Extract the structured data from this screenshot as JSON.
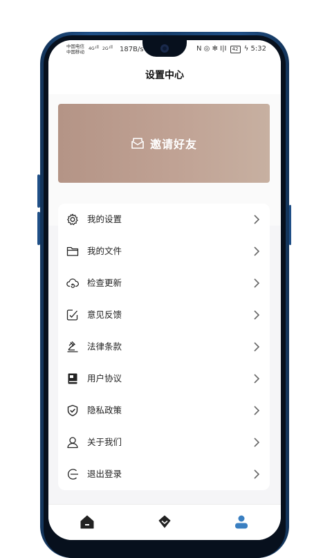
{
  "status_bar": {
    "carrier1": "中国电信",
    "carrier2": "中国移动",
    "net1": "4G",
    "net2": "2G",
    "speed": "187B/s",
    "icons": "N ◎ ✻ I|I",
    "battery": "42",
    "time": "5:32"
  },
  "header": {
    "title": "设置中心"
  },
  "invite": {
    "label": "邀请好友",
    "icon": "mail-icon"
  },
  "menu": {
    "items": [
      {
        "label": "我的设置",
        "icon": "gear-icon"
      },
      {
        "label": "我的文件",
        "icon": "folder-icon"
      },
      {
        "label": "检查更新",
        "icon": "cloud-refresh-icon"
      },
      {
        "label": "意见反馈",
        "icon": "feedback-edit-icon"
      },
      {
        "label": "法律条款",
        "icon": "gavel-icon"
      },
      {
        "label": "用户协议",
        "icon": "book-icon"
      },
      {
        "label": "隐私政策",
        "icon": "shield-check-icon"
      },
      {
        "label": "关于我们",
        "icon": "person-icon"
      },
      {
        "label": "退出登录",
        "icon": "logout-icon"
      }
    ]
  },
  "tabs": [
    {
      "icon": "home-icon"
    },
    {
      "icon": "diamond-icon"
    },
    {
      "icon": "user-icon",
      "active": true
    }
  ],
  "colors": {
    "accent": "#3a7fc1",
    "icon": "#222222",
    "invite_bg": "#bb9d8f"
  }
}
